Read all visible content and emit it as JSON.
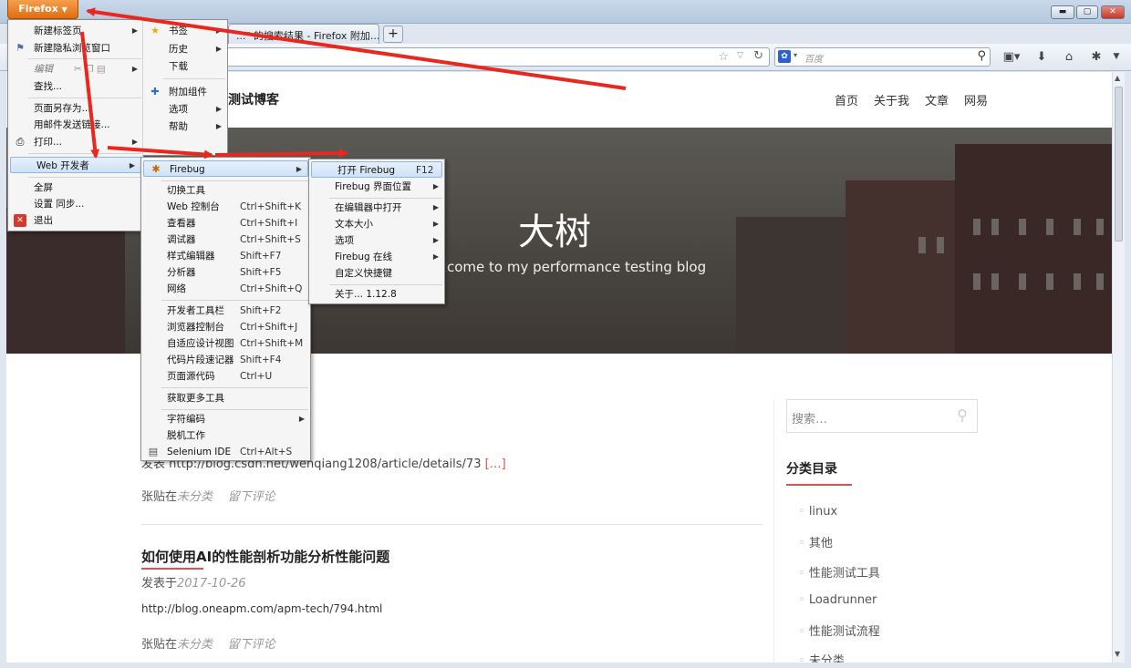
{
  "window": {
    "app_button": "Firefox",
    "min": "▬",
    "max": "▢",
    "close": "✕"
  },
  "tabs": [
    {
      "label": "...\" 的搜索结果 - Firefox 附加..."
    }
  ],
  "newtab": "+",
  "nav": {
    "search_placeholder": "百度"
  },
  "site": {
    "brand": "测试博客",
    "nav": [
      "首页",
      "关于我",
      "文章",
      "网易"
    ],
    "hero_title": "大树",
    "hero_sub": "come to my performance testing blog",
    "post1_excerpt": "发表 http://blog.csdn.net/wenqiang1208/article/details/73",
    "post1_more": "[…]",
    "post1_meta_prefix": "张贴在",
    "post1_cat": "未分类",
    "post1_comment": "留下评论",
    "post2_title": "如何使用AI的性能剖析功能分析性能问题",
    "post2_date_prefix": "发表于",
    "post2_date": "2017-10-26",
    "post2_body": "http://blog.oneapm.com/apm-tech/794.html",
    "post2_meta_prefix": "张贴在",
    "post2_cat": "未分类",
    "post2_comment": "留下评论",
    "search_placeholder": "搜索…",
    "sidebar_heading": "分类目录",
    "categories": [
      "linux",
      "其他",
      "性能测试工具",
      "Loadrunner",
      "性能测试流程",
      "未分类"
    ]
  },
  "menu_main": [
    "新建标签页",
    "新建隐私浏览窗口",
    "编辑",
    "查找...",
    "页面另存为...",
    "用邮件发送链接...",
    "打印...",
    "Web 开发者",
    "全屏",
    "设置 同步...",
    "退出"
  ],
  "menu_right": [
    "书签",
    "历史",
    "下载",
    "附加组件",
    "选项",
    "帮助"
  ],
  "menu_webdev": [
    {
      "label": "Firebug",
      "key": ""
    },
    {
      "label": "切换工具",
      "key": ""
    },
    {
      "label": "Web 控制台",
      "key": "Ctrl+Shift+K"
    },
    {
      "label": "查看器",
      "key": "Ctrl+Shift+I"
    },
    {
      "label": "调试器",
      "key": "Ctrl+Shift+S"
    },
    {
      "label": "样式编辑器",
      "key": "Shift+F7"
    },
    {
      "label": "分析器",
      "key": "Shift+F5"
    },
    {
      "label": "网络",
      "key": "Ctrl+Shift+Q"
    },
    {
      "label": "开发者工具栏",
      "key": "Shift+F2"
    },
    {
      "label": "浏览器控制台",
      "key": "Ctrl+Shift+J"
    },
    {
      "label": "自适应设计视图",
      "key": "Ctrl+Shift+M"
    },
    {
      "label": "代码片段速记器",
      "key": "Shift+F4"
    },
    {
      "label": "页面源代码",
      "key": "Ctrl+U"
    },
    {
      "label": "获取更多工具",
      "key": ""
    },
    {
      "label": "字符编码",
      "key": ""
    },
    {
      "label": "脱机工作",
      "key": ""
    },
    {
      "label": "Selenium IDE",
      "key": "Ctrl+Alt+S"
    }
  ],
  "menu_firebug": [
    {
      "label": "打开 Firebug",
      "key": "F12"
    },
    {
      "label": "Firebug 界面位置",
      "key": ""
    },
    {
      "label": "在编辑器中打开",
      "key": ""
    },
    {
      "label": "文本大小",
      "key": ""
    },
    {
      "label": "选项",
      "key": ""
    },
    {
      "label": "Firebug 在线",
      "key": ""
    },
    {
      "label": "自定义快捷键",
      "key": ""
    },
    {
      "label": "关于... 1.12.8",
      "key": ""
    }
  ]
}
